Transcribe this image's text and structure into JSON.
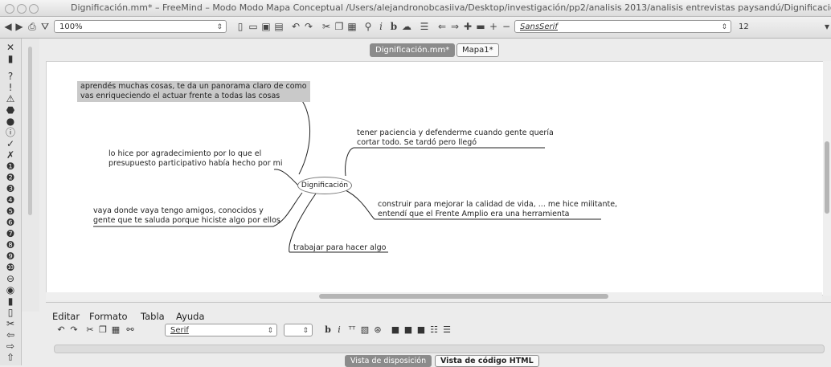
{
  "window": {
    "title": "Dignificación.mm* – FreeMind – Modo Modo Mapa Conceptual /Users/alejandronobcasiiva/Desktop/investigación/pp2/analisis 2013/analisis entrevistas paysandú/Dignificación.mm"
  },
  "toolbar": {
    "zoom_value": "100%",
    "font_name": "SansSerif",
    "font_size": "12"
  },
  "tabs": [
    {
      "label": "Dignificación.mm*",
      "active": true
    },
    {
      "label": "Mapa1*",
      "active": false
    }
  ],
  "mindmap": {
    "root": "Dignificación",
    "nodes": [
      {
        "id": "n1",
        "lines": [
          "aprendés muchas cosas, te da un panorama claro de como",
          "vas enriqueciendo el actuar frente a todas las cosas"
        ],
        "selected": true
      },
      {
        "id": "n2",
        "lines": [
          "lo hice por agradecimiento por lo que el",
          "presupuesto participativo había hecho por mi"
        ],
        "selected": false
      },
      {
        "id": "n3",
        "lines": [
          "vaya donde vaya tengo amigos, conocidos y",
          "gente que te saluda porque hiciste algo por ellos"
        ],
        "selected": false
      },
      {
        "id": "n4",
        "lines": [
          "trabajar para hacer algo"
        ],
        "selected": false
      },
      {
        "id": "n5",
        "lines": [
          "tener paciencia y defenderme cuando gente quería",
          "cortar todo. Se tardó pero llegó"
        ],
        "selected": false
      },
      {
        "id": "n6",
        "lines": [
          "construir para mejorar la calidad de vida,  ... me hice militante,",
          "entendí que el Frente Amplio era una herramienta"
        ],
        "selected": false
      }
    ]
  },
  "editor": {
    "menus": [
      "Editar",
      "Formato",
      "Tabla",
      "Ayuda"
    ],
    "font_name": "Serif",
    "bold": "b",
    "italic": "i"
  },
  "bottom_tabs": [
    {
      "label": "Vista de disposición",
      "active": true
    },
    {
      "label": "Vista de código HTML",
      "active": false
    }
  ],
  "icons": {
    "toolbar": [
      "back-icon",
      "forward-icon",
      "print-icon",
      "filter-icon",
      "new-icon",
      "open-icon",
      "save-icon",
      "save-as-icon",
      "undo-icon",
      "redo-icon",
      "cut-icon",
      "copy-icon",
      "paste-icon",
      "find-icon",
      "italic-icon",
      "bold-icon",
      "cloud-icon",
      "edge-icon",
      "fold-icon",
      "expand-icon"
    ],
    "left_palette": [
      "close-icon",
      "remove-icons-icon",
      "question-icon",
      "exclamation-icon",
      "warning-icon",
      "stop-icon",
      "ok-icon",
      "cancel-icon",
      "priority-icons"
    ]
  }
}
